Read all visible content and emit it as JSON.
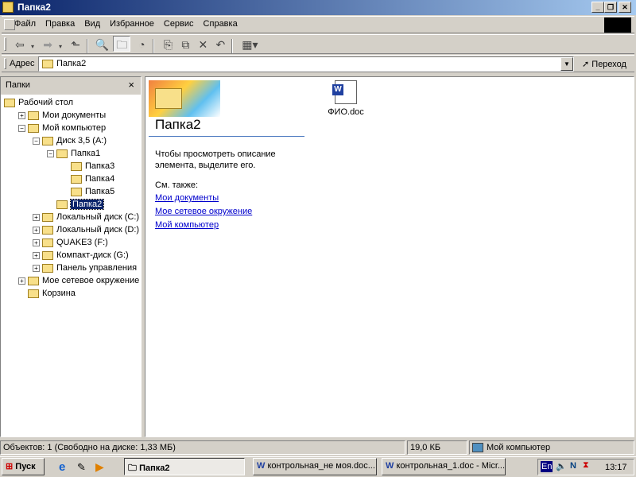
{
  "window": {
    "title": "Папка2"
  },
  "menu": [
    "Файл",
    "Правка",
    "Вид",
    "Избранное",
    "Сервис",
    "Справка"
  ],
  "address": {
    "label": "Адрес",
    "value": "Папка2",
    "go": "Переход"
  },
  "folders_pane": {
    "title": "Папки",
    "close": "×"
  },
  "tree": [
    {
      "label": "Рабочий стол",
      "level": 0,
      "exp": ""
    },
    {
      "label": "Мои документы",
      "level": 1,
      "exp": "+"
    },
    {
      "label": "Мой компьютер",
      "level": 1,
      "exp": "-"
    },
    {
      "label": "Диск 3,5 (A:)",
      "level": 2,
      "exp": "-"
    },
    {
      "label": "Папка1",
      "level": 3,
      "exp": "-"
    },
    {
      "label": "Папка3",
      "level": 4,
      "exp": ""
    },
    {
      "label": "Папка4",
      "level": 4,
      "exp": ""
    },
    {
      "label": "Папка5",
      "level": 4,
      "exp": ""
    },
    {
      "label": "Папка2",
      "level": 3,
      "exp": "",
      "selected": true
    },
    {
      "label": "Локальный диск (C:)",
      "level": 2,
      "exp": "+"
    },
    {
      "label": "Локальный диск (D:)",
      "level": 2,
      "exp": "+"
    },
    {
      "label": "QUAKE3 (F:)",
      "level": 2,
      "exp": "+"
    },
    {
      "label": "Компакт-диск (G:)",
      "level": 2,
      "exp": "+"
    },
    {
      "label": "Панель управления",
      "level": 2,
      "exp": "+"
    },
    {
      "label": "Мое сетевое окружение",
      "level": 1,
      "exp": "+"
    },
    {
      "label": "Корзина",
      "level": 1,
      "exp": ""
    }
  ],
  "info": {
    "folder": "Папка2",
    "hint": "Чтобы просмотреть описание элемента, выделите его.",
    "see_also": "См. также:",
    "links": [
      "Мои документы",
      "Мое сетевое окружение",
      "Мой компьютер"
    ]
  },
  "files": [
    {
      "name": "ФИО.doc"
    }
  ],
  "status": {
    "objects": "Объектов: 1 (Свободно на диске: 1,33 МБ)",
    "size": "19,0 КБ",
    "location": "Мой компьютер"
  },
  "taskbar": {
    "start": "Пуск",
    "tasks": [
      "Папка2",
      "контрольная_не моя.doc...",
      "контрольная_1.doc - Micr..."
    ],
    "lang": "En",
    "clock": "13:17"
  }
}
